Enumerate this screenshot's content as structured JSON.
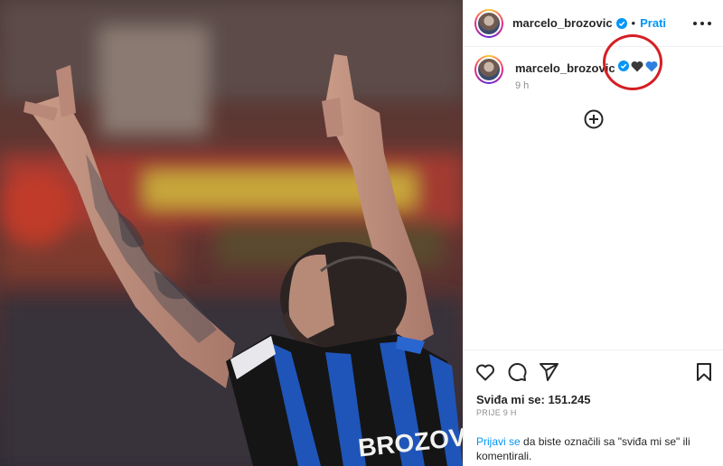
{
  "post": {
    "username": "marcelo_brozovic",
    "dot": "•",
    "follow_label": "Prati",
    "more_icon": "more-horizontal-icon",
    "verified_icon": "verified-badge-icon",
    "caption": {
      "username": "marcelo_brozovic",
      "emojis": [
        "black-heart",
        "blue-heart"
      ],
      "time": "9 h"
    },
    "annotation_color": "#d41f24",
    "jersey_name": "BROZOVIĆ",
    "likes_label": "Sviđa mi se: 151.245",
    "date": "PRIJE 9 H",
    "login_link": "Prijavi se",
    "login_text": " da biste označili sa \"sviđa mi se\" ili komentirali."
  },
  "colors": {
    "accent": "#0095f6",
    "text": "#262626",
    "muted": "#8e8e8e",
    "annotation": "#d41f24",
    "jersey_blue": "#1f55b8",
    "jersey_black": "#151515"
  }
}
